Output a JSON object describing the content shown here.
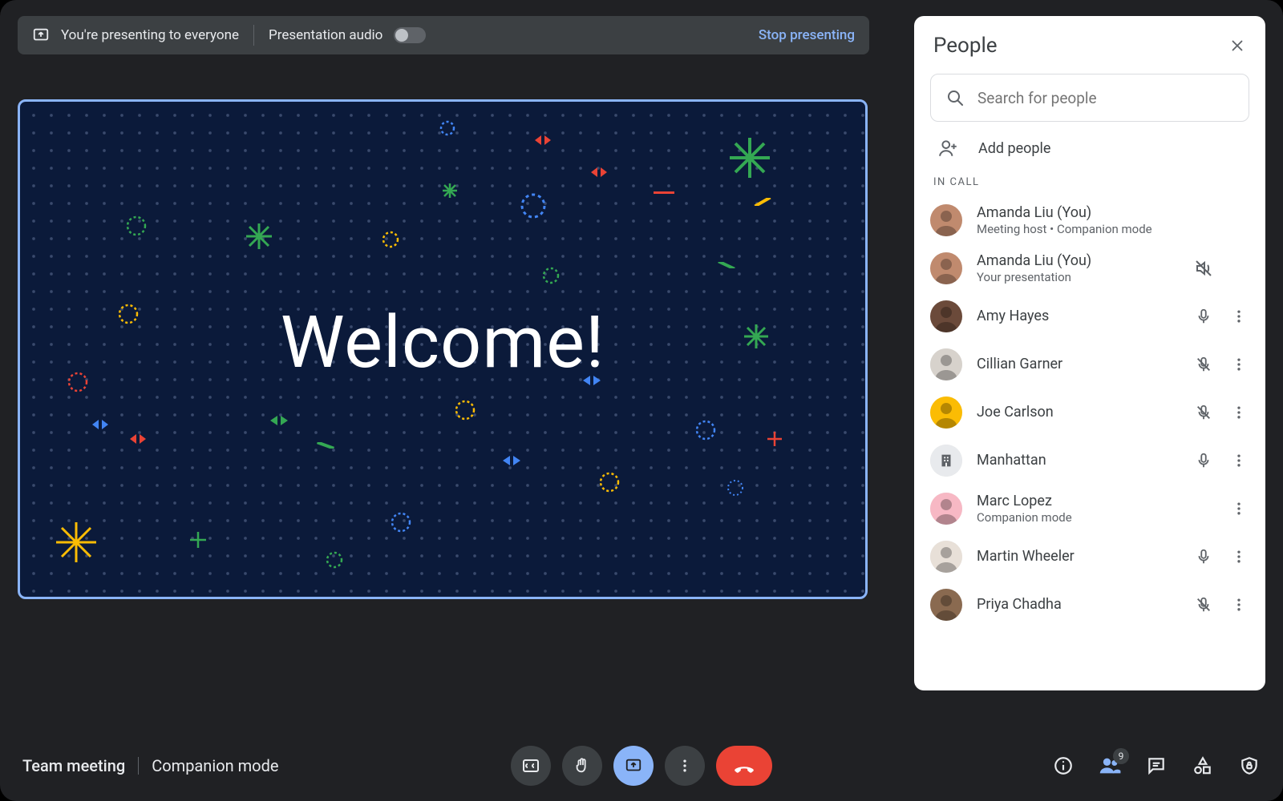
{
  "banner": {
    "presenting_text": "You're presenting to everyone",
    "audio_label": "Presentation audio",
    "audio_on": false,
    "stop_label": "Stop presenting"
  },
  "presentation": {
    "slide_title": "Welcome!"
  },
  "footer": {
    "meeting_name": "Team meeting",
    "mode_label": "Companion mode",
    "people_count": "9"
  },
  "panel": {
    "title": "People",
    "search_placeholder": "Search for people",
    "add_label": "Add people",
    "section_label": "IN CALL",
    "participants": [
      {
        "name": "Amanda Liu (You)",
        "sub": "Meeting host • Companion mode",
        "mic": "none",
        "menu": false,
        "avatar": "#c08a6e"
      },
      {
        "name": "Amanda Liu (You)",
        "sub": "Your presentation",
        "mic": "speaker-muted",
        "menu": false,
        "avatar": "#c08a6e"
      },
      {
        "name": "Amy Hayes",
        "sub": "",
        "mic": "on",
        "menu": true,
        "avatar": "#6b4a3a"
      },
      {
        "name": "Cillian Garner",
        "sub": "",
        "mic": "muted",
        "menu": true,
        "avatar": "#d7d2cc"
      },
      {
        "name": "Joe Carlson",
        "sub": "",
        "mic": "muted",
        "menu": true,
        "avatar": "#fbbc04"
      },
      {
        "name": "Manhattan",
        "sub": "",
        "mic": "on",
        "menu": true,
        "avatar": "room"
      },
      {
        "name": "Marc Lopez",
        "sub": "Companion mode",
        "mic": "none",
        "menu": true,
        "avatar": "#f7b8c4"
      },
      {
        "name": "Martin Wheeler",
        "sub": "",
        "mic": "on",
        "menu": true,
        "avatar": "#e8e0d8"
      },
      {
        "name": "Priya Chadha",
        "sub": "",
        "mic": "muted",
        "menu": true,
        "avatar": "#8a6a50"
      }
    ]
  }
}
